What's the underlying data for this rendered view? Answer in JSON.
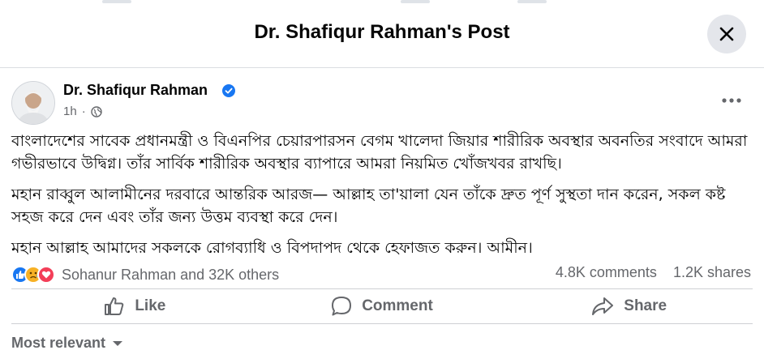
{
  "dialog": {
    "title": "Dr. Shafiqur Rahman's Post"
  },
  "post": {
    "author": "Dr. Shafiqur Rahman",
    "time": "1h",
    "paragraphs": [
      "বাংলাদেশের সাবেক প্রধানমন্ত্রী ও বিএনপির চেয়ারপারসন বেগম খালেদা জিয়ার শারীরিক অবস্থার অবনতির সংবাদে আমরা গভীরভাবে উদ্বিগ্ন। তাঁর সার্বিক শারীরিক অবস্থার ব্যাপারে আমরা নিয়মিত খোঁজখবর রাখছি।",
      "মহান রাব্বুল আলামীনের দরবারে আন্তরিক আরজ— আল্লাহ তা'য়ালা যেন তাঁকে দ্রুত পূর্ণ সুস্থতা দান করেন, সকল কষ্ট সহজ করে দেন এবং তাঁর জন্য উত্তম ব্যবস্থা করে দেন।",
      "মহান আল্লাহ আমাদের সকলকে রোগব্যাধি ও বিপদাপদ থেকে হেফাজত করুন। আমীন।"
    ],
    "reactions_text": "Sohanur Rahman and 32K others",
    "comments_count": "4.8K comments",
    "shares_count": "1.2K shares"
  },
  "actions": {
    "like": "Like",
    "comment": "Comment",
    "share": "Share"
  },
  "comments": {
    "sort_label": "Most relevant"
  },
  "icons": {
    "close": "close-icon",
    "verified": "verified-badge-icon",
    "privacy": "globe-icon",
    "more": "more-horizontal-icon",
    "like_reaction": "like-reaction-icon",
    "sad_reaction": "sad-reaction-icon",
    "love_reaction": "love-reaction-icon"
  },
  "colors": {
    "verified": "#1877f2",
    "like_reaction": "#1877f2",
    "love_reaction": "#f33e58",
    "sad_reaction": "#f7b125",
    "muted_text": "#65676b"
  }
}
